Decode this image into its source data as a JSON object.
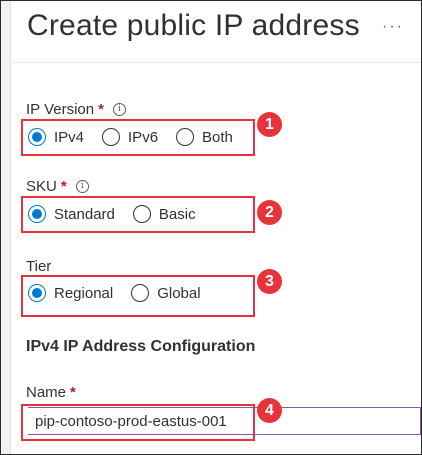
{
  "header": {
    "title": "Create public IP address",
    "more_label": "···"
  },
  "ip_version": {
    "label": "IP Version",
    "required_marker": "*",
    "info_glyph": "i",
    "options": [
      {
        "label": "IPv4",
        "checked": true
      },
      {
        "label": "IPv6",
        "checked": false
      },
      {
        "label": "Both",
        "checked": false
      }
    ],
    "callout": "1"
  },
  "sku": {
    "label": "SKU",
    "required_marker": "*",
    "info_glyph": "i",
    "options": [
      {
        "label": "Standard",
        "checked": true
      },
      {
        "label": "Basic",
        "checked": false
      }
    ],
    "callout": "2"
  },
  "tier": {
    "label": "Tier",
    "options": [
      {
        "label": "Regional",
        "checked": true
      },
      {
        "label": "Global",
        "checked": false
      }
    ],
    "callout": "3"
  },
  "ipv4_config": {
    "heading": "IPv4 IP Address Configuration"
  },
  "name_field": {
    "label": "Name",
    "required_marker": "*",
    "value": "pip-contoso-prod-eastus-001",
    "callout": "4"
  },
  "colors": {
    "accent": "#0078d4",
    "highlight": "#e8333a",
    "required": "#a4262c"
  }
}
